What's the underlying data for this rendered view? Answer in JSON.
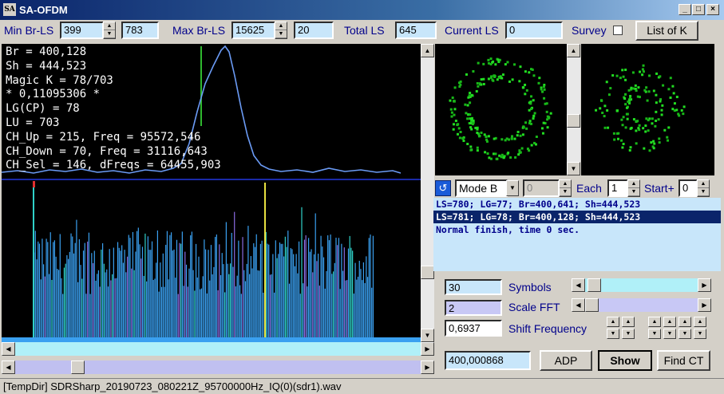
{
  "window": {
    "title": "SA-OFDM",
    "minimize": "_",
    "maximize": "□",
    "close": "×"
  },
  "top": {
    "min_br_ls_label": "Min Br-LS",
    "min_br_ls_value": "399",
    "min_br_ls_aux": "783",
    "max_br_ls_label": "Max Br-LS",
    "max_br_ls_value": "15625",
    "max_br_ls_aux": "20",
    "total_ls_label": "Total LS",
    "total_ls_value": "645",
    "current_ls_label": "Current LS",
    "current_ls_value": "0",
    "survey_label": "Survey",
    "list_of_k_button": "List of K"
  },
  "info_lines": [
    "Br = 400,128",
    "Sh = 444,523",
    "Magic K = 78/703",
    "* 0,11095306 *",
    "LG(CP) = 78",
    "LU = 703",
    "CH_Up = 215, Freq = 95572,546",
    "CH_Down = 70, Freq = 31116,643",
    "CH_Sel = 146, dFreqs = 64455,903"
  ],
  "mode": {
    "icon": "undo-icon",
    "mode_value": "Mode B",
    "num_value": "0",
    "each_label": "Each",
    "each_value": "1",
    "start_label": "Start+",
    "start_value": "0"
  },
  "log": [
    "LS=780; LG=77; Br=400,641; Sh=444,523",
    "LS=781; LG=78; Br=400,128; Sh=444,523",
    "Normal finish, time 0 sec."
  ],
  "controls": {
    "symbols_value": "30",
    "symbols_label": "Symbols",
    "scale_fft_value": "2",
    "scale_fft_label": "Scale FFT",
    "shift_value": "0,6937",
    "shift_label": "Shift Frequency",
    "freq_value": "400,000868",
    "adp_button": "ADP",
    "show_button": "Show",
    "find_ct_button": "Find CT"
  },
  "status": {
    "path": "[TempDir] SDRSharp_20190723_080221Z_95700000Hz_IQ(0)(sdr1).wav"
  }
}
